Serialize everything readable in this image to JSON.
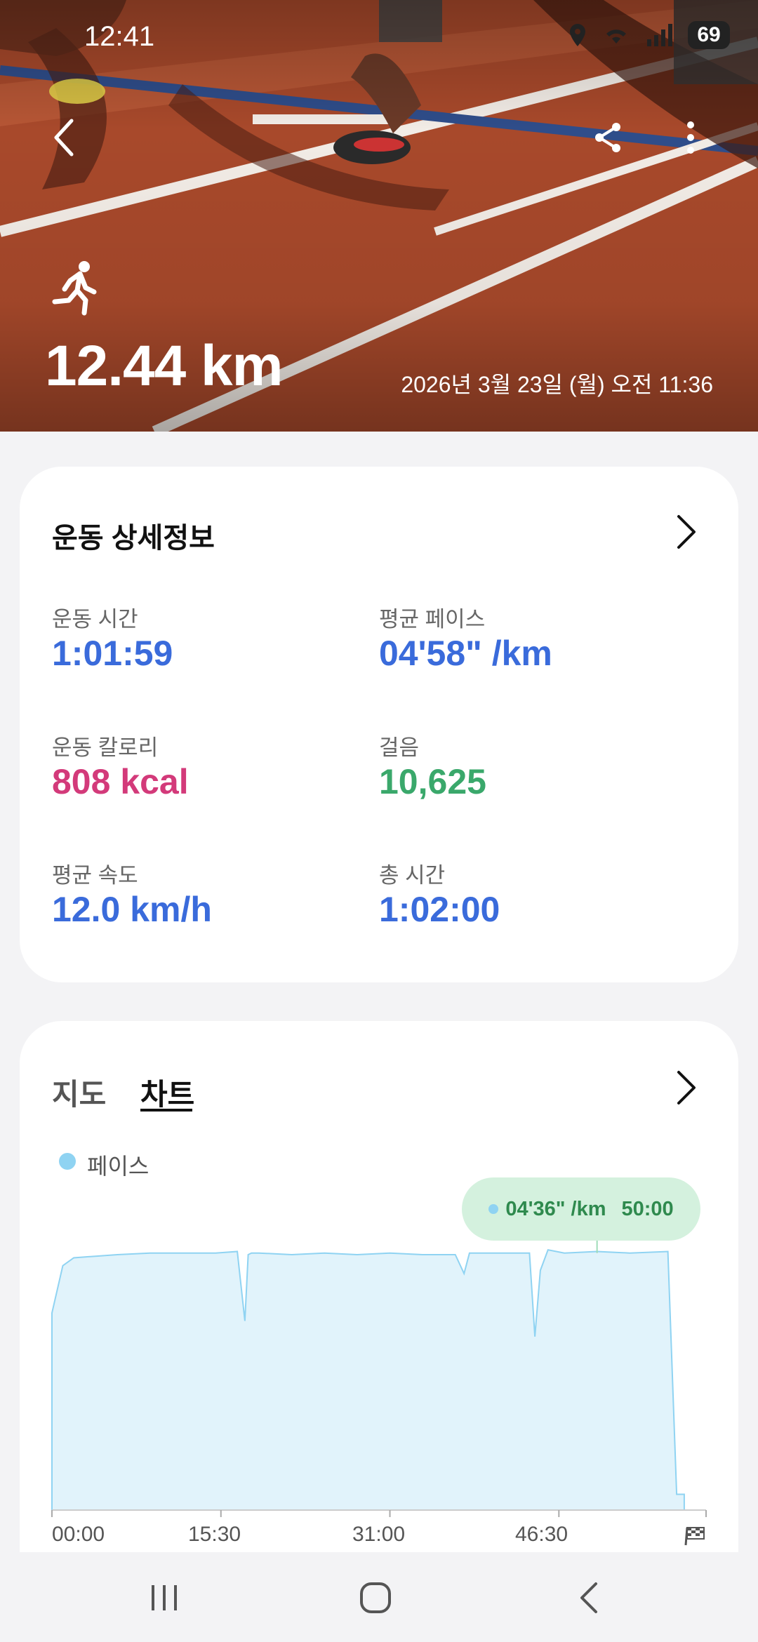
{
  "status_bar": {
    "time": "12:41",
    "battery": "69"
  },
  "header": {
    "activity_icon": "running-person-icon",
    "distance": "12.44 km",
    "date": "2026년 3월 23일 (월) 오전 11:36",
    "back_icon": "back-arrow-icon",
    "share_icon": "share-icon",
    "more_icon": "more-vertical-icon"
  },
  "details": {
    "title": "운동 상세정보",
    "metrics": [
      {
        "label": "운동 시간",
        "value": "1:01:59",
        "color": "#3a6bdb"
      },
      {
        "label": "평균 페이스",
        "value": "04'58\" /km",
        "color": "#3a6bdb"
      },
      {
        "label": "운동 칼로리",
        "value": "808 kcal",
        "color": "#d33a7a"
      },
      {
        "label": "걸음",
        "value": "10,625",
        "color": "#3aa86b"
      },
      {
        "label": "평균 속도",
        "value": "12.0 km/h",
        "color": "#3a6bdb"
      },
      {
        "label": "총 시간",
        "value": "1:02:00",
        "color": "#3a6bdb"
      }
    ]
  },
  "chart_section": {
    "tabs": [
      {
        "label": "지도",
        "active": false
      },
      {
        "label": "차트",
        "active": true
      }
    ],
    "legend": "페이스",
    "tooltip": {
      "pace": "04'36\" /km",
      "time": "50:00"
    }
  },
  "chart_data": {
    "type": "area",
    "series": [
      {
        "name": "페이스",
        "color": "#8fd3f2"
      }
    ],
    "x_ticks": [
      "00:00",
      "15:30",
      "31:00",
      "46:30"
    ],
    "end_icon": "finish-flag-icon",
    "x": [
      0,
      1,
      2,
      4,
      6,
      9,
      12,
      15,
      17,
      17.7,
      18,
      18.3,
      19,
      22,
      25,
      28,
      31,
      34,
      37,
      37.8,
      38.3,
      39,
      42,
      43.8,
      44.3,
      44.8,
      45.5,
      47,
      50,
      53,
      56.5,
      57.3,
      58
    ],
    "values": [
      285,
      255,
      250,
      249,
      248,
      247,
      247,
      247,
      246,
      290,
      248,
      247,
      247,
      248,
      247,
      248,
      247,
      248,
      248,
      260,
      247,
      247,
      247,
      247,
      300,
      258,
      245,
      247,
      246,
      247,
      246,
      400,
      400
    ],
    "xlim": [
      0,
      60
    ],
    "highlight": {
      "x": 50,
      "label_pace": "04'36\" /km",
      "label_time": "50:00"
    }
  },
  "nav": {
    "recent_icon": "recent-apps-icon",
    "home_icon": "home-icon",
    "back_icon": "nav-back-icon"
  }
}
